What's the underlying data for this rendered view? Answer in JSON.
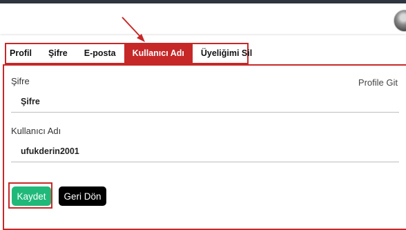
{
  "tabs": [
    {
      "label": "Profil",
      "active": false
    },
    {
      "label": "Şifre",
      "active": false
    },
    {
      "label": "E-posta",
      "active": false
    },
    {
      "label": "Kullanıcı Adı",
      "active": true
    },
    {
      "label": "Üyeliğimi Sil",
      "active": false
    }
  ],
  "form": {
    "password_label": "Şifre",
    "password_placeholder": "Şifre",
    "username_label": "Kullanıcı Adı",
    "username_value": "ufukderin2001",
    "profile_link": "Profile Git"
  },
  "buttons": {
    "save": "Kaydet",
    "back": "Geri Dön"
  },
  "colors": {
    "active_tab": "#c62828",
    "highlight_outline": "#c62828",
    "save_button": "#20b97a",
    "back_button": "#000000"
  },
  "icons": [
    "user-avatar",
    "annotation-arrow"
  ]
}
